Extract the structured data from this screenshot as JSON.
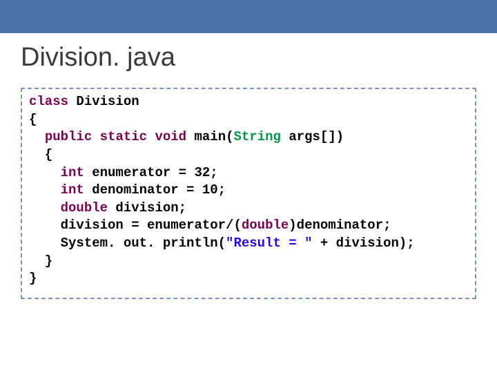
{
  "title": "Division. java",
  "code": {
    "l1_kw1": "class",
    "l1_txt": " Division",
    "l2": "{",
    "l3_ind": "  ",
    "l3_kw1": "public",
    "l3_sp1": " ",
    "l3_kw2": "static",
    "l3_sp2": " ",
    "l3_kw3": "void",
    "l3_sp3": " ",
    "l3_m": "main",
    "l3_p1": "(",
    "l3_ty": "String",
    "l3_p2": " args[])",
    "l4": "  {",
    "l5_ind": "    ",
    "l5_kw": "int",
    "l5_txt": " enumerator = 32;",
    "l6_ind": "    ",
    "l6_kw": "int",
    "l6_txt": " denominator = 10;",
    "l7_ind": "    ",
    "l7_kw": "double",
    "l7_txt": " division;",
    "l8": "    division = enumerator/(",
    "l8_kw": "double",
    "l8_tail": ")denominator;",
    "l9_a": "    System. out. println(",
    "l9_str": "\"Result = \"",
    "l9_b": " + division);",
    "l10": "  }",
    "l11": "}"
  }
}
